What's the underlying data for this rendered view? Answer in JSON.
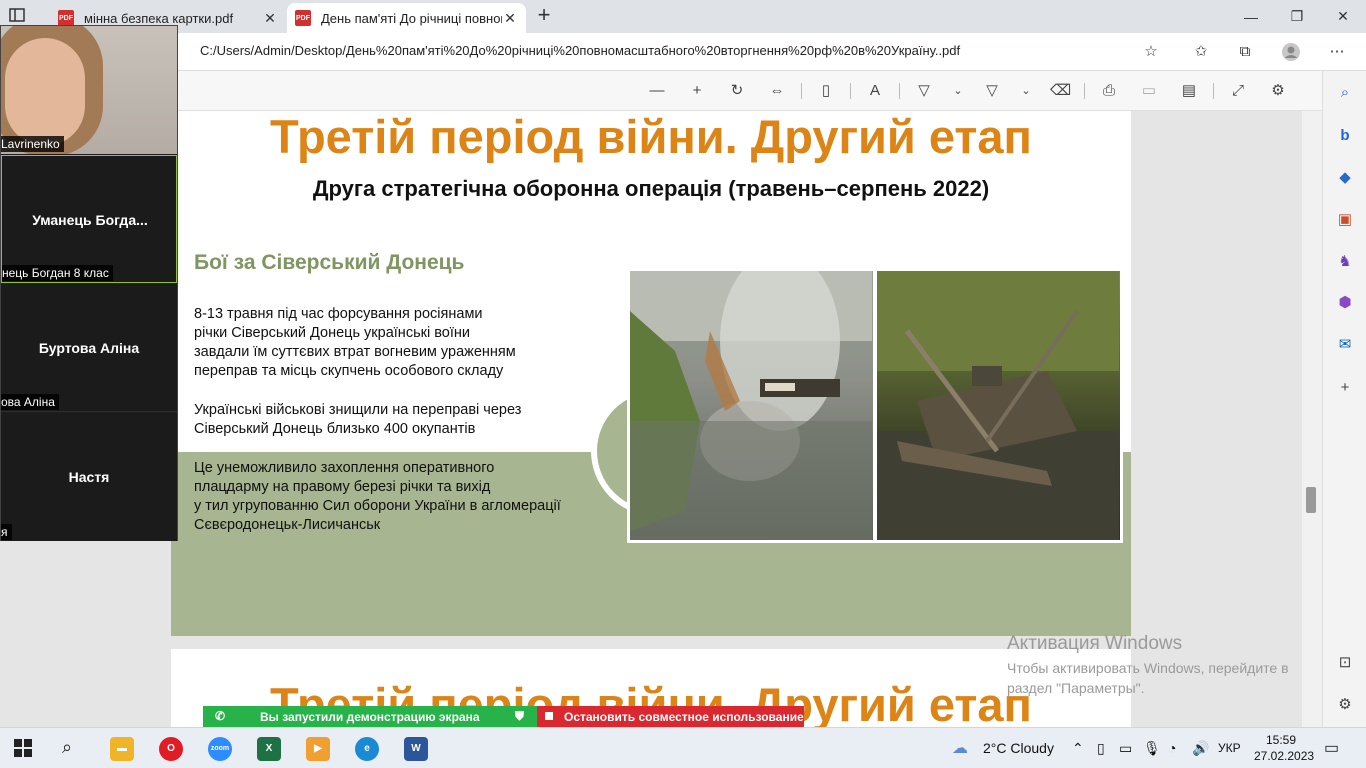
{
  "browser": {
    "tabs": [
      {
        "label": "мінна безпека картки.pdf"
      },
      {
        "label": "День пам'яті До річниці повном"
      }
    ],
    "url": "C:/Users/Admin/Desktop/День%20пам'яті%20До%20річниці%20повномасштабного%20вторгнення%20рф%20в%20Україну..pdf"
  },
  "slide1": {
    "title": "Третій період війни. Другий етап",
    "subtitle": "Друга стратегічна оборонна операція (травень–серпень 2022)",
    "section_heading": "Бої за Сіверський Донець",
    "paragraph1": [
      "8-13 травня під час форсування росіянами",
      "річки Сіверський Донець українські воїни",
      "завдали їм суттєвих втрат вогневим ураженням",
      "переправ та місць скупчень особового складу"
    ],
    "paragraph2": [
      "Українські військові знищили на переправі через",
      "Сіверський Донець близько 400 окупантів"
    ],
    "paragraph3": [
      "Це унеможливило захоплення оперативного",
      "плацдарму на правому березі річки та вихід",
      "у тил угрупованню Сил оборони України в агломерації",
      "Сєвєродонецьк-Лисичанськ"
    ]
  },
  "slide2": {
    "title": "Третій період війни. Другий етап"
  },
  "zoom": {
    "participants": [
      {
        "name_label": "Lavrinenko",
        "big_name": ""
      },
      {
        "name_label": "нець Богдан 8 клас",
        "big_name": "Уманець  Богда..."
      },
      {
        "name_label": "ова Аліна",
        "big_name": "Буртова Аліна"
      },
      {
        "name_label": "я",
        "big_name": "Настя"
      }
    ]
  },
  "share": {
    "status": "Вы запустили демонстрацию экрана",
    "stop": "Остановить совместное использование"
  },
  "activation": {
    "line1": "Активация Windows",
    "line2": "Чтобы активировать Windows, перейдите в",
    "line3": "раздел \"Параметры\"."
  },
  "taskbar": {
    "weather": "2°C  Cloudy",
    "lang": "УКР",
    "time": "15:59",
    "date": "27.02.2023",
    "apps": [
      "file-explorer",
      "opera",
      "zoom",
      "excel",
      "video-editor",
      "edge",
      "word"
    ]
  },
  "colors": {
    "title_orange": "#dd8416",
    "heading_green": "#7e9660",
    "band_green": "#a7b591",
    "share_green": "#27b24a",
    "stop_red": "#d9282f"
  }
}
